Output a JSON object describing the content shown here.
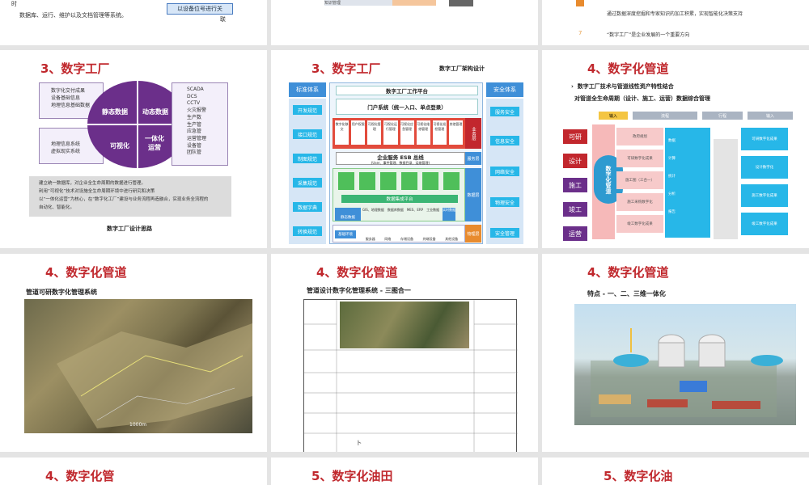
{
  "row0": {
    "s1_lines": [
      "时",
      "数据库、运行、维护以及文档管理等系统。"
    ],
    "s1_btn": "以设备位号进行关",
    "s1_btn2": "联",
    "s2_tag": "知识管理",
    "s3_lines": [
      "通过数据深度挖掘和专家知识的加工积累，实现智能化决策支持",
      "“数字工厂”是企业发展的一个重要方向"
    ],
    "s3_num": "7"
  },
  "slide4": {
    "title": "3、数字工厂",
    "left_list": [
      "数字化交付成果",
      "设备基础信息",
      "地理信息基础数据"
    ],
    "left_list2": [
      "地理信息系统",
      "虚拟现实系统"
    ],
    "quad": [
      "静态数据",
      "动态数据",
      "可视化",
      "一体化运营"
    ],
    "right_list": [
      "SCADA",
      "DCS",
      "CCTV",
      "火灾报警",
      "生产数",
      "生产管",
      "应急管",
      "运营管理",
      "设备管",
      "团队管"
    ],
    "text": [
      "建立统一数据库，对企业全生命周期的数据进行管理。",
      "利用“可视化”技术对设施全生命周期环境中进行研究和决策",
      "以“一体化运营”为核心，在“数字化工厂”建设与业务流程再造融合，实现业务全流程的",
      "自动化、智能化。"
    ],
    "caption": "数字工厂设计思路"
  },
  "slide5": {
    "title": "3、数字工厂",
    "header": "数字工厂架构设计",
    "left_label": "标准体系",
    "left_items": [
      "开发规范",
      "接口规范",
      "制图规范",
      "采集规范",
      "数据字典",
      "转换规范"
    ],
    "right_label": "安全体系",
    "right_items": [
      "服务安全",
      "信息安全",
      "网络安全",
      "物理安全",
      "安全管理"
    ],
    "platform": "数字工厂工作平台",
    "portal": "门户系统（统一入口、单点登录）",
    "modules": [
      "数字化移交",
      "用户权限",
      "可视化管理",
      "可视化运行管理",
      "可视化应急管理",
      "可视化维修管理",
      "可视化巡检管理",
      "其他管理"
    ],
    "biz_layer": "业务层",
    "esb": "企业服务 ESB 总线",
    "esb_sub": "(User、事件管理、数据目录、运维管理)",
    "svc_layer": "服务层",
    "data_layer": "数据层",
    "integrate": "数据集成平台",
    "data_row": [
      "GIS、地理数据",
      "数据库数据",
      "MES、ERP",
      "工业数据",
      "实时数据"
    ],
    "data_block": "静态数据",
    "infra": "基础环境",
    "phys_layer": "物理层",
    "infra_items": [
      "服务器",
      "网络",
      "存储设备",
      "终端设备",
      "其他设备"
    ]
  },
  "slide6": {
    "title": "4、数字化管道",
    "bullet": "数字工厂技术与管道线性资产特性结合",
    "sub": "对管道全生命周期（设计、施工、运营）数据综合管理",
    "stages": [
      "可研",
      "设计",
      "施工",
      "竣工",
      "运营"
    ],
    "headers": [
      "输入",
      "流程",
      "行程",
      "输入"
    ],
    "center": "数字化管道",
    "pink_items": [
      "政府规划",
      "可研数字化成果",
      "施工图（三合一）",
      "施工采购数字化",
      "竣工数字化成果"
    ],
    "cyan_items": [
      "数据",
      "计算",
      "统计",
      "分析",
      "报告"
    ],
    "right_items": [
      "可研数字化成果",
      "设计数字化",
      "施工数字化成果",
      "竣工数字化成果"
    ]
  },
  "slide7": {
    "title": "4、数字化管道",
    "subtitle": "管道可研数字化管理系统",
    "scale": "1000m"
  },
  "slide8": {
    "title": "4、数字化管道",
    "subtitle": "管道设计数字化管理系统 - 三图合一",
    "bottom_char": "卜"
  },
  "slide9": {
    "title": "4、数字化管道",
    "subtitle": "特点 - 一、二、三维一体化"
  },
  "row3": [
    "4、数字化管",
    "5、数字化油田",
    "5、数字化油"
  ],
  "colors": {
    "red": "#c2272d",
    "blue": "#3f8fd8",
    "cyan": "#27b7e8",
    "purple": "#6b2f8a"
  }
}
